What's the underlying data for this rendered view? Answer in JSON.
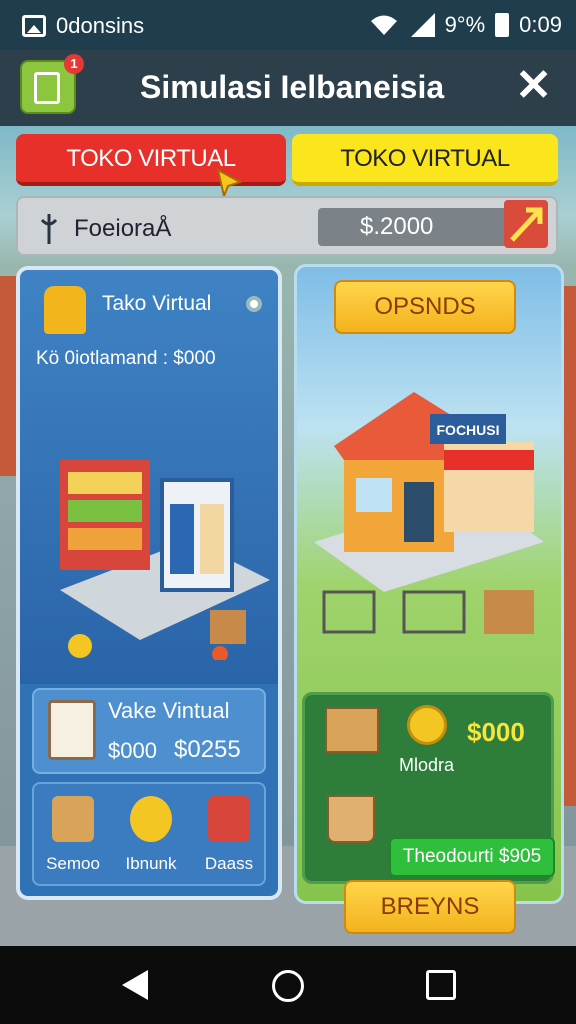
{
  "status_bar": {
    "app_name": "0donsins",
    "battery_percent": "9°%",
    "time": "0:09",
    "icons": [
      "image-icon",
      "wifi-icon",
      "signal-icon",
      "battery-icon"
    ]
  },
  "title_bar": {
    "title": "Simulasi Ielbaneisia",
    "badge_count": "1",
    "icons": [
      "app-icon",
      "close-icon"
    ]
  },
  "tabs": [
    {
      "label": "TOKO VIRTUAL",
      "color": "#e8302a"
    },
    {
      "label": "TOKO VIRTUAL",
      "color": "#fbe51c"
    }
  ],
  "info_bar": {
    "label": "FoeioraÅ",
    "money": "$.2000"
  },
  "left_panel": {
    "title": "Tako Virtual",
    "demand_line": "Kö 0iotlamand : $000",
    "store_card": {
      "name": "Vake Vintual",
      "price1": "$000",
      "price2": "$0255"
    },
    "items": [
      {
        "label": "Semoo",
        "icon": "box-icon"
      },
      {
        "label": "Ibnunk",
        "icon": "coins-icon"
      },
      {
        "label": "Daass",
        "icon": "bag-icon"
      }
    ]
  },
  "right_panel": {
    "top_button": "OPSNDS",
    "shop_sign": "FOCHUSI",
    "green_box": {
      "amount": "$000",
      "label": "Mlodra",
      "button": "Theodourti $905"
    },
    "bottom_button": "BREYNS"
  },
  "colors": {
    "accent_green": "#2e7d3b",
    "accent_yellow": "#fbe51c",
    "accent_red": "#e8302a",
    "panel_blue": "#2f73b6"
  }
}
